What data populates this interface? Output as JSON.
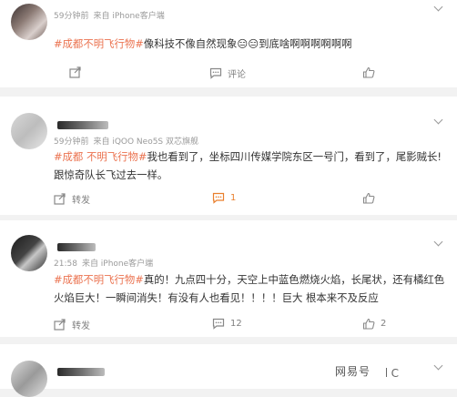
{
  "posts": [
    {
      "meta": {
        "time": "59分钟前",
        "source": "来自 iPhone客户端"
      },
      "hashtag": "#成都不明飞行物#",
      "text": "像科技不像自然现象😑😑到底啥啊啊啊啊啊啊",
      "actions": {
        "share": "",
        "comment": "评论",
        "like": ""
      }
    },
    {
      "meta": {
        "time": "59分钟前",
        "source": "来自 iQOO Neo5S 双芯旗舰"
      },
      "hashtag": "#成都 不明飞行物#",
      "text": "我也看到了，坐标四川传媒学院东区一号门，看到了，尾影贼长!跟惊奇队长飞过去一样。",
      "actions": {
        "share": "转发",
        "comment": "1",
        "like": ""
      }
    },
    {
      "meta": {
        "time": "21:58",
        "source": "来自 iPhone客户端"
      },
      "hashtag": "#成都不明飞行物#",
      "text": "真的！九点四十分，天空上中蓝色燃烧火焰，长尾状，还有橘红色火焰巨大！一瞬间消失！有没有人也看见！！！！巨大 根本来不及反应",
      "actions": {
        "share": "转发",
        "comment": "12",
        "like": "2"
      }
    }
  ],
  "watermark": {
    "text": "网易号",
    "suffix": "C"
  },
  "colors": {
    "hashtag": "#eb7350",
    "comment_active": "#e97f2c",
    "meta": "#9a9a9a"
  }
}
